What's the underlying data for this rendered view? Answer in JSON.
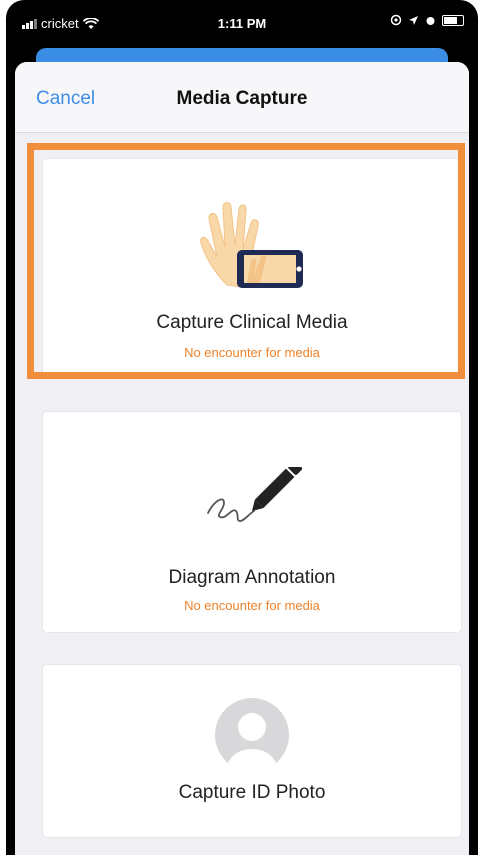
{
  "status_bar": {
    "carrier": "cricket",
    "time": "1:11 PM"
  },
  "navbar": {
    "cancel_label": "Cancel",
    "title": "Media Capture"
  },
  "options": [
    {
      "title": "Capture Clinical Media",
      "subtitle": "No encounter for media",
      "icon": "hand-phone-icon",
      "highlighted": true
    },
    {
      "title": "Diagram Annotation",
      "subtitle": "No encounter for media",
      "icon": "pen-annotation-icon",
      "highlighted": false
    },
    {
      "title": "Capture ID Photo",
      "subtitle": "",
      "icon": "person-photo-icon",
      "highlighted": false
    }
  ],
  "colors": {
    "accent_blue": "#3f8ee6",
    "warning_orange": "#f0822a",
    "highlight_orange": "#f08e3c",
    "background": "#efeff4"
  }
}
